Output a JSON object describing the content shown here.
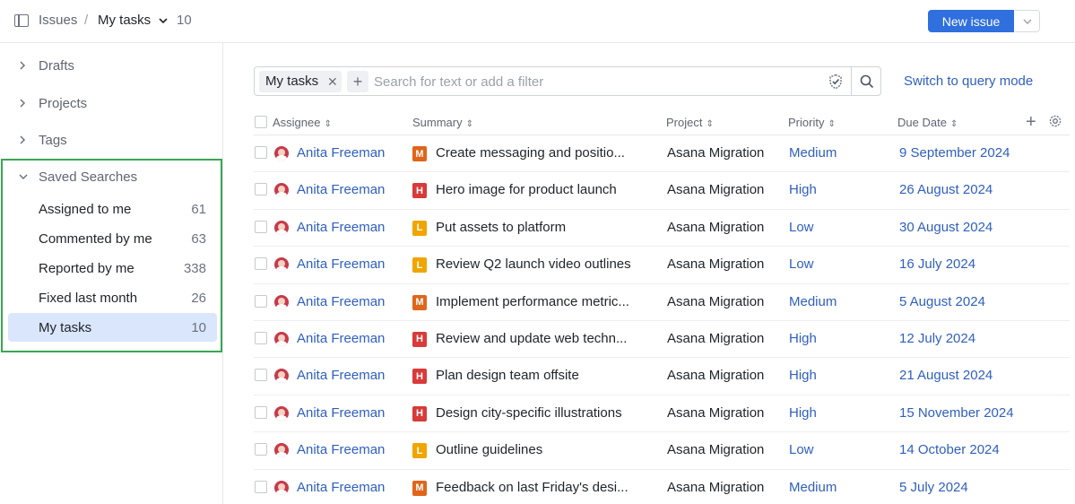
{
  "header": {
    "breadcrumb_root": "Issues",
    "breadcrumb_sep": "/",
    "current_view": "My tasks",
    "count": "10",
    "new_issue_label": "New issue"
  },
  "sidebar": {
    "sections": [
      {
        "label": "Drafts"
      },
      {
        "label": "Projects"
      },
      {
        "label": "Tags"
      }
    ],
    "saved_searches": {
      "label": "Saved Searches",
      "items": [
        {
          "label": "Assigned to me",
          "count": "61"
        },
        {
          "label": "Commented by me",
          "count": "63"
        },
        {
          "label": "Reported by me",
          "count": "338"
        },
        {
          "label": "Fixed last month",
          "count": "26"
        },
        {
          "label": "My tasks",
          "count": "10",
          "active": true
        }
      ]
    }
  },
  "search": {
    "chip_label": "My tasks",
    "chip_remove": "✕",
    "add_filter": "+",
    "placeholder": "Search for text or add a filter",
    "value": "",
    "query_mode_link": "Switch to query mode"
  },
  "table": {
    "columns": [
      "Assignee",
      "Summary",
      "Project",
      "Priority",
      "Due Date"
    ],
    "sort_glyph": "⇕",
    "add_column": "+",
    "priority_colors": {
      "M": "#e0651b",
      "H": "#d93a3a",
      "L": "#f0a500"
    },
    "rows": [
      {
        "assignee": "Anita Freeman",
        "badge": "M",
        "summary": "Create messaging and positio...",
        "project": "Asana Migration",
        "priority": "Medium",
        "due": "9 September 2024"
      },
      {
        "assignee": "Anita Freeman",
        "badge": "H",
        "summary": "Hero image for product launch",
        "project": "Asana Migration",
        "priority": "High",
        "due": "26 August 2024"
      },
      {
        "assignee": "Anita Freeman",
        "badge": "L",
        "summary": "Put assets to platform",
        "project": "Asana Migration",
        "priority": "Low",
        "due": "30 August 2024"
      },
      {
        "assignee": "Anita Freeman",
        "badge": "L",
        "summary": "Review Q2 launch video outlines",
        "project": "Asana Migration",
        "priority": "Low",
        "due": "16 July 2024"
      },
      {
        "assignee": "Anita Freeman",
        "badge": "M",
        "summary": "Implement performance metric...",
        "project": "Asana Migration",
        "priority": "Medium",
        "due": "5 August 2024"
      },
      {
        "assignee": "Anita Freeman",
        "badge": "H",
        "summary": "Review and update web techn...",
        "project": "Asana Migration",
        "priority": "High",
        "due": "12 July 2024"
      },
      {
        "assignee": "Anita Freeman",
        "badge": "H",
        "summary": "Plan design team offsite",
        "project": "Asana Migration",
        "priority": "High",
        "due": "21 August 2024"
      },
      {
        "assignee": "Anita Freeman",
        "badge": "H",
        "summary": "Design city-specific illustrations",
        "project": "Asana Migration",
        "priority": "High",
        "due": "15 November 2024"
      },
      {
        "assignee": "Anita Freeman",
        "badge": "L",
        "summary": "Outline guidelines",
        "project": "Asana Migration",
        "priority": "Low",
        "due": "14 October 2024"
      },
      {
        "assignee": "Anita Freeman",
        "badge": "M",
        "summary": "Feedback on last Friday's desi...",
        "project": "Asana Migration",
        "priority": "Medium",
        "due": "5 July 2024"
      }
    ]
  }
}
